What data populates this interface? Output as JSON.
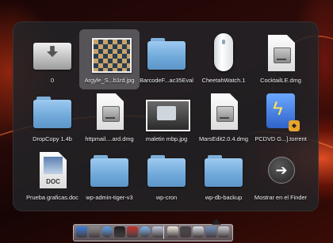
{
  "stack": {
    "items": [
      {
        "label": "0",
        "icon": "download-disk-icon"
      },
      {
        "label": "Argyle_S...b1rd.jpg",
        "icon": "argyle-image-icon"
      },
      {
        "label": "BarcodeF...ac35Eval",
        "icon": "folder-icon"
      },
      {
        "label": "CheetahWatch.1",
        "icon": "mouse-icon"
      },
      {
        "label": "CocktailLE.dmg",
        "icon": "disk-image-icon"
      },
      {
        "label": "DropCopy 1.4b",
        "icon": "folder-icon"
      },
      {
        "label": "httpmail....ard.dmg",
        "icon": "disk-image-icon"
      },
      {
        "label": "maletin mbp.jpg",
        "icon": "photo-icon"
      },
      {
        "label": "MarsEdit2.0.4.dmg",
        "icon": "disk-image-icon"
      },
      {
        "label": "PCDVD G...].torrent",
        "icon": "torrent-icon"
      },
      {
        "label": "Prueba graficas.doc",
        "icon": "word-doc-icon"
      },
      {
        "label": "wp-admin-tiger-v3",
        "icon": "folder-icon"
      },
      {
        "label": "wp-cron",
        "icon": "folder-icon"
      },
      {
        "label": "wp-db-backup",
        "icon": "folder-icon"
      },
      {
        "label": "Mostrar en el Finder",
        "icon": "show-in-finder-icon"
      }
    ],
    "selected_index": 1,
    "doc_tag": "DOC",
    "show_finder_glyph": "➔"
  },
  "dock": {
    "items": [
      {
        "icon": "finder-icon",
        "color": "#3b7bd8"
      },
      {
        "icon": "system-prefs-icon",
        "color": "#8a8a8a"
      },
      {
        "icon": "safari-icon",
        "color": "#5aa0e8"
      },
      {
        "icon": "terminal-icon",
        "color": "#1a1a1a"
      },
      {
        "icon": "photo-booth-icon",
        "color": "#c4322b"
      },
      {
        "icon": "itunes-icon",
        "color": "#7fb6ea"
      },
      {
        "icon": "mail-icon",
        "color": "#b9c6d3"
      },
      {
        "icon": "ical-icon",
        "color": "#ece7da"
      },
      {
        "icon": "stack-icon",
        "color": "#444444"
      },
      {
        "icon": "screen-icon",
        "color": "#d8dde4"
      },
      {
        "icon": "documents-icon",
        "color": "#6c8fb8"
      },
      {
        "icon": "trash-icon",
        "color": "#c9ccd1"
      }
    ]
  },
  "colors": {
    "panel": "#232326",
    "folder": "#7fb1dc",
    "label": "#f2f2f2"
  }
}
